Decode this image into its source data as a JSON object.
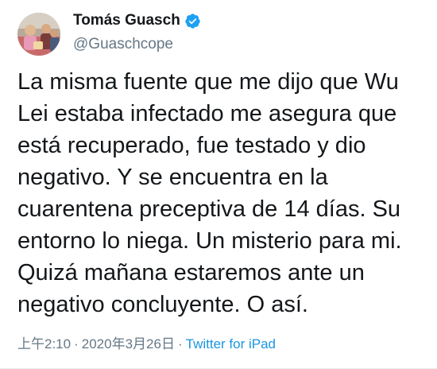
{
  "tweet": {
    "author": {
      "display_name": "Tomás Guasch",
      "handle": "@Guaschcope",
      "verified_icon": "verified-badge-icon",
      "avatar_icon": "avatar-photo"
    },
    "text": "La misma fuente que me dijo que Wu\nLei estaba infectado me asegura que\nestá recuperado, fue testado y dio\nnegativo. Y se encuentra en la\ncuarentena preceptiva de 14 días. Su\nentorno lo niega. Un misterio para mi.\nQuizá mañana estaremos ante un\nnegativo concluyente. O así.",
    "time": "上午2:10",
    "separator": "·",
    "date": "2020年3月26日",
    "source": "Twitter for iPad"
  },
  "colors": {
    "text": "#14171a",
    "secondary": "#657786",
    "link": "#1b95e0",
    "verified": "#1da1f2"
  }
}
